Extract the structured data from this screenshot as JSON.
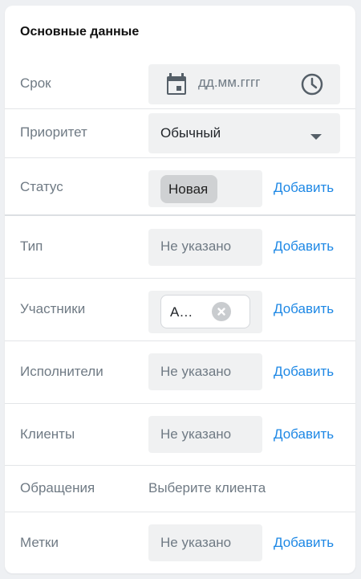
{
  "section": {
    "title": "Основные данные"
  },
  "colors": {
    "accent": "#1e88e5",
    "label": "#6f7a84",
    "field_bg": "#f0f1f2"
  },
  "rows": {
    "deadline": {
      "label": "Срок",
      "placeholder": "дд.мм.гггг",
      "icons": [
        "calendar-icon",
        "clock-icon"
      ]
    },
    "priority": {
      "label": "Приоритет",
      "value": "Обычный",
      "icon": "dropdown-arrow-icon"
    },
    "status": {
      "label": "Статус",
      "value": "Новая",
      "add": "Добавить"
    },
    "type": {
      "label": "Тип",
      "value": "Не указано",
      "add": "Добавить"
    },
    "participants": {
      "label": "Участники",
      "tag": "А…",
      "add": "Добавить",
      "icon": "remove-tag-icon"
    },
    "executors": {
      "label": "Исполнители",
      "value": "Не указано",
      "add": "Добавить"
    },
    "clients": {
      "label": "Клиенты",
      "value": "Не указано",
      "add": "Добавить"
    },
    "requests": {
      "label": "Обращения",
      "value": "Выберите клиента"
    },
    "tags": {
      "label": "Метки",
      "value": "Не указано",
      "add": "Добавить"
    }
  }
}
